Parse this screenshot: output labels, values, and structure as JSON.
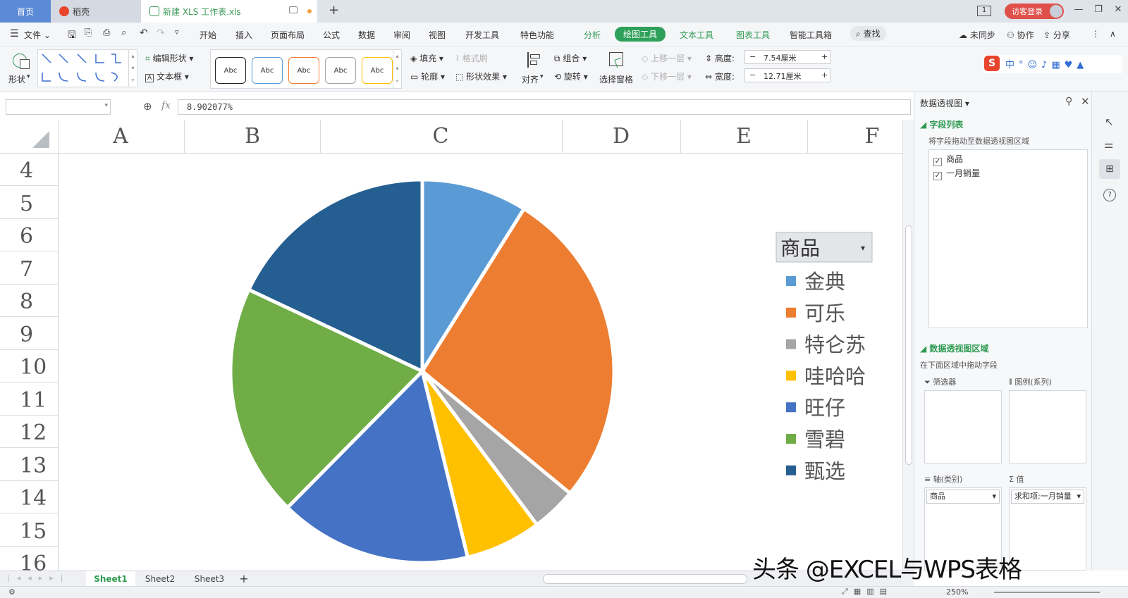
{
  "titlebar": {
    "tab_home": "首页",
    "tab_daoke": "稻壳",
    "tab_file": "新建 XLS 工作表.xls",
    "new_tab": "+",
    "guest_login": "访客登录",
    "badge": "1"
  },
  "menubar": {
    "file": "文件",
    "items": [
      "开始",
      "插入",
      "页面布局",
      "公式",
      "数据",
      "审阅",
      "视图",
      "开发工具",
      "特色功能"
    ],
    "analyze": "分析",
    "drawing_tools": "绘图工具",
    "text_tools": "文本工具",
    "chart_tools": "图表工具",
    "smart_toolbox": "智能工具箱",
    "search": "查找",
    "unsynced": "未同步",
    "collaborate": "协作",
    "share": "分享"
  },
  "ribbon": {
    "shape": "形状",
    "edit_shape": "编辑形状",
    "textbox": "文本框",
    "style_samples": [
      "Abc",
      "Abc",
      "Abc",
      "Abc",
      "Abc"
    ],
    "fill": "填充",
    "format_painter": "格式刷",
    "outline": "轮廓",
    "shape_effects": "形状效果",
    "align": "对齐",
    "group": "组合",
    "rotate": "旋转",
    "selection_pane": "选择窗格",
    "bring_forward": "上移一层",
    "send_backward": "下移一层",
    "height_label": "高度:",
    "height_value": "7.54厘米",
    "width_label": "宽度:",
    "width_value": "12.71厘米",
    "spin_minus": "−",
    "spin_plus": "+"
  },
  "formula": {
    "name_box": "",
    "fx": "fx",
    "value": "8.902077%"
  },
  "grid": {
    "columns": [
      "A",
      "B",
      "C",
      "D",
      "E",
      "F"
    ],
    "rows": [
      "4",
      "5",
      "6",
      "7",
      "8",
      "9",
      "10",
      "11",
      "12",
      "13",
      "14",
      "15",
      "16"
    ]
  },
  "chart_data": {
    "type": "pie",
    "field_button": "商品",
    "categories": [
      "金典",
      "可乐",
      "特仑苏",
      "哇哈哈",
      "旺仔",
      "雪碧",
      "甄选"
    ],
    "values": [
      8.9,
      27.1,
      3.8,
      6.4,
      16.2,
      19.6,
      18.0
    ],
    "colors": [
      "#5b9bd5",
      "#ed7d31",
      "#a5a5a5",
      "#ffc000",
      "#4472c4",
      "#70ad47",
      "#255e91"
    ],
    "legend": "right"
  },
  "panel": {
    "title": "数据透视图",
    "field_list": "字段列表",
    "field_hint": "将字段拖动至数据透视图区域",
    "fields": [
      "商品",
      "一月销量"
    ],
    "area_title": "数据透视图区域",
    "area_hint": "在下面区域中拖动字段",
    "filter": "筛选器",
    "legend_series": "图例(系列)",
    "axis_category": "轴(类别)",
    "values_label": "值",
    "axis_value": "商品",
    "values_value": "求和项:一月销量"
  },
  "sheets": {
    "tabs": [
      "Sheet1",
      "Sheet2",
      "Sheet3"
    ],
    "add": "+"
  },
  "status": {
    "zoom": "250%"
  },
  "watermark": "头条 @EXCEL与WPS表格"
}
